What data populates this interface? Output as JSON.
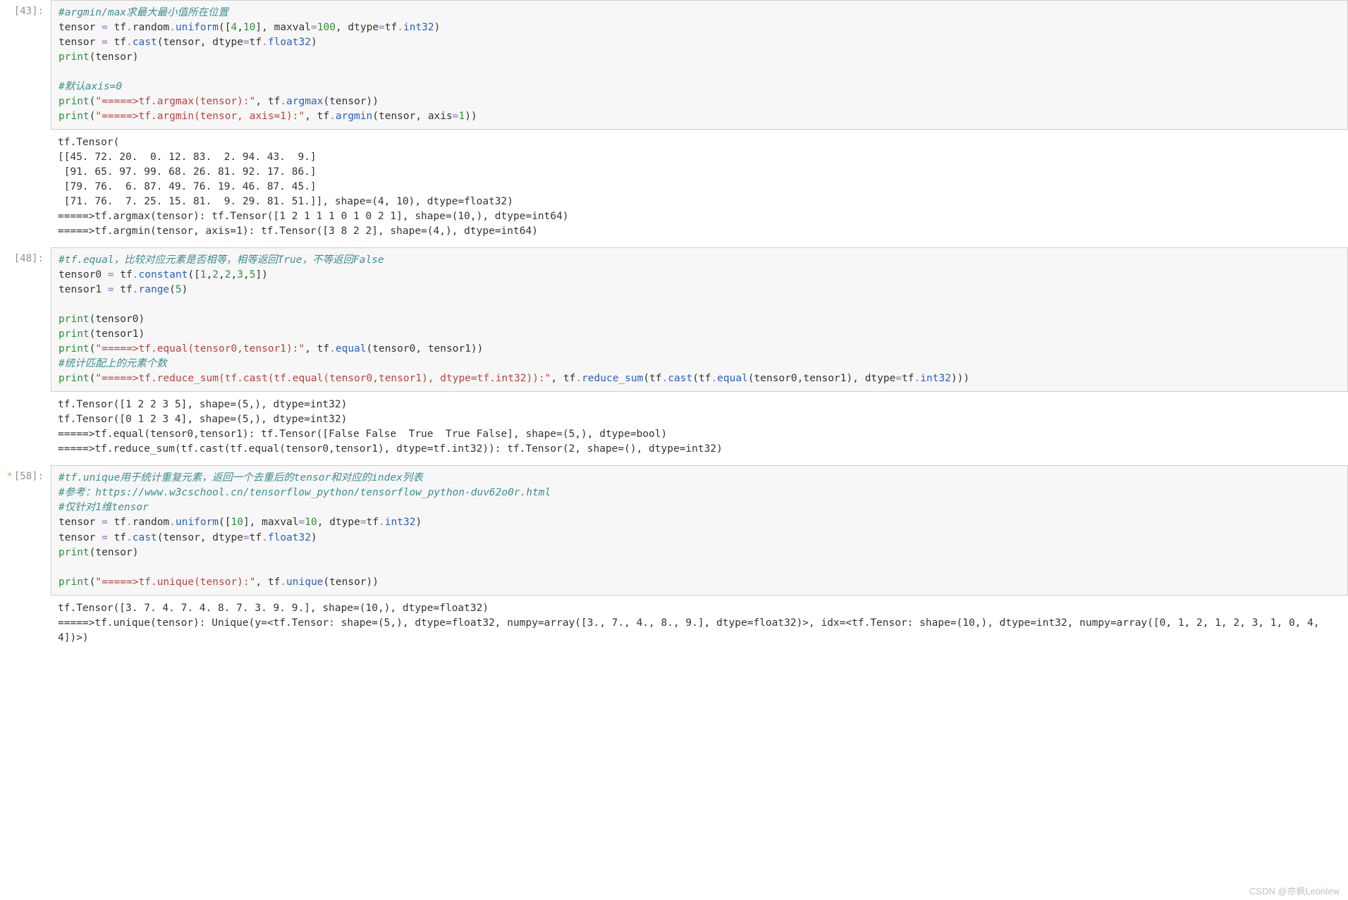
{
  "watermark": "CSDN @亦枫Leonlew",
  "cells": [
    {
      "prompt": "[43]:",
      "modified": false,
      "code": [
        {
          "cls": "c-comment",
          "t": "#argmin/max求最大最小值所在位置"
        },
        [
          {
            "cls": "",
            "t": "tensor "
          },
          {
            "cls": "c-op",
            "t": "="
          },
          {
            "cls": "",
            "t": " tf"
          },
          {
            "cls": "c-op",
            "t": "."
          },
          {
            "cls": "",
            "t": "random"
          },
          {
            "cls": "c-op",
            "t": "."
          },
          {
            "cls": "c-func",
            "t": "uniform"
          },
          {
            "cls": "",
            "t": "(["
          },
          {
            "cls": "c-num",
            "t": "4"
          },
          {
            "cls": "",
            "t": ","
          },
          {
            "cls": "c-num",
            "t": "10"
          },
          {
            "cls": "",
            "t": "], maxval"
          },
          {
            "cls": "c-op",
            "t": "="
          },
          {
            "cls": "c-num",
            "t": "100"
          },
          {
            "cls": "",
            "t": ", dtype"
          },
          {
            "cls": "c-op",
            "t": "="
          },
          {
            "cls": "",
            "t": "tf"
          },
          {
            "cls": "c-op",
            "t": "."
          },
          {
            "cls": "c-func",
            "t": "int32"
          },
          {
            "cls": "",
            "t": ")"
          }
        ],
        [
          {
            "cls": "",
            "t": "tensor "
          },
          {
            "cls": "c-op",
            "t": "="
          },
          {
            "cls": "",
            "t": " tf"
          },
          {
            "cls": "c-op",
            "t": "."
          },
          {
            "cls": "c-func",
            "t": "cast"
          },
          {
            "cls": "",
            "t": "(tensor, dtype"
          },
          {
            "cls": "c-op",
            "t": "="
          },
          {
            "cls": "",
            "t": "tf"
          },
          {
            "cls": "c-op",
            "t": "."
          },
          {
            "cls": "c-func",
            "t": "float32"
          },
          {
            "cls": "",
            "t": ")"
          }
        ],
        [
          {
            "cls": "c-kw",
            "t": "print"
          },
          {
            "cls": "",
            "t": "(tensor)"
          }
        ],
        {
          "blank": true
        },
        {
          "cls": "c-comment",
          "t": "#默认axis=0"
        },
        [
          {
            "cls": "c-kw",
            "t": "print"
          },
          {
            "cls": "",
            "t": "("
          },
          {
            "cls": "c-str",
            "t": "\"=====>tf.argmax(tensor):\""
          },
          {
            "cls": "",
            "t": ", tf"
          },
          {
            "cls": "c-op",
            "t": "."
          },
          {
            "cls": "c-func",
            "t": "argmax"
          },
          {
            "cls": "",
            "t": "(tensor))"
          }
        ],
        [
          {
            "cls": "c-kw",
            "t": "print"
          },
          {
            "cls": "",
            "t": "("
          },
          {
            "cls": "c-str",
            "t": "\"=====>tf.argmin(tensor, axis=1):\""
          },
          {
            "cls": "",
            "t": ", tf"
          },
          {
            "cls": "c-op",
            "t": "."
          },
          {
            "cls": "c-func",
            "t": "argmin"
          },
          {
            "cls": "",
            "t": "(tensor, axis"
          },
          {
            "cls": "c-op",
            "t": "="
          },
          {
            "cls": "c-num",
            "t": "1"
          },
          {
            "cls": "",
            "t": "))"
          }
        ]
      ],
      "output": "tf.Tensor(\n[[45. 72. 20.  0. 12. 83.  2. 94. 43.  9.]\n [91. 65. 97. 99. 68. 26. 81. 92. 17. 86.]\n [79. 76.  6. 87. 49. 76. 19. 46. 87. 45.]\n [71. 76.  7. 25. 15. 81.  9. 29. 81. 51.]], shape=(4, 10), dtype=float32)\n=====>tf.argmax(tensor): tf.Tensor([1 2 1 1 1 0 1 0 2 1], shape=(10,), dtype=int64)\n=====>tf.argmin(tensor, axis=1): tf.Tensor([3 8 2 2], shape=(4,), dtype=int64)"
    },
    {
      "prompt": "[48]:",
      "modified": false,
      "code": [
        {
          "cls": "c-comment",
          "t": "#tf.equal，比较对应元素是否相等，相等返回True，不等返回False"
        },
        [
          {
            "cls": "",
            "t": "tensor0 "
          },
          {
            "cls": "c-op",
            "t": "="
          },
          {
            "cls": "",
            "t": " tf"
          },
          {
            "cls": "c-op",
            "t": "."
          },
          {
            "cls": "c-func",
            "t": "constant"
          },
          {
            "cls": "",
            "t": "(["
          },
          {
            "cls": "c-num",
            "t": "1"
          },
          {
            "cls": "",
            "t": ","
          },
          {
            "cls": "c-num",
            "t": "2"
          },
          {
            "cls": "",
            "t": ","
          },
          {
            "cls": "c-num",
            "t": "2"
          },
          {
            "cls": "",
            "t": ","
          },
          {
            "cls": "c-num",
            "t": "3"
          },
          {
            "cls": "",
            "t": ","
          },
          {
            "cls": "c-num",
            "t": "5"
          },
          {
            "cls": "",
            "t": "])"
          }
        ],
        [
          {
            "cls": "",
            "t": "tensor1 "
          },
          {
            "cls": "c-op",
            "t": "="
          },
          {
            "cls": "",
            "t": " tf"
          },
          {
            "cls": "c-op",
            "t": "."
          },
          {
            "cls": "c-func",
            "t": "range"
          },
          {
            "cls": "",
            "t": "("
          },
          {
            "cls": "c-num",
            "t": "5"
          },
          {
            "cls": "",
            "t": ")"
          }
        ],
        {
          "blank": true
        },
        [
          {
            "cls": "c-kw",
            "t": "print"
          },
          {
            "cls": "",
            "t": "(tensor0)"
          }
        ],
        [
          {
            "cls": "c-kw",
            "t": "print"
          },
          {
            "cls": "",
            "t": "(tensor1)"
          }
        ],
        [
          {
            "cls": "c-kw",
            "t": "print"
          },
          {
            "cls": "",
            "t": "("
          },
          {
            "cls": "c-str",
            "t": "\"=====>tf.equal(tensor0,tensor1):\""
          },
          {
            "cls": "",
            "t": ", tf"
          },
          {
            "cls": "c-op",
            "t": "."
          },
          {
            "cls": "c-func",
            "t": "equal"
          },
          {
            "cls": "",
            "t": "(tensor0, tensor1))"
          }
        ],
        {
          "cls": "c-comment",
          "t": "#统计匹配上的元素个数"
        },
        [
          {
            "cls": "c-kw",
            "t": "print"
          },
          {
            "cls": "",
            "t": "("
          },
          {
            "cls": "c-str",
            "t": "\"=====>tf.reduce_sum(tf.cast(tf.equal(tensor0,tensor1), dtype=tf.int32)):\""
          },
          {
            "cls": "",
            "t": ", tf"
          },
          {
            "cls": "c-op",
            "t": "."
          },
          {
            "cls": "c-func",
            "t": "reduce_sum"
          },
          {
            "cls": "",
            "t": "(tf"
          },
          {
            "cls": "c-op",
            "t": "."
          },
          {
            "cls": "c-func",
            "t": "cast"
          },
          {
            "cls": "",
            "t": "(tf"
          },
          {
            "cls": "c-op",
            "t": "."
          },
          {
            "cls": "c-func",
            "t": "equal"
          },
          {
            "cls": "",
            "t": "(tensor0,tensor1), dtype"
          },
          {
            "cls": "c-op",
            "t": "="
          },
          {
            "cls": "",
            "t": "tf"
          },
          {
            "cls": "c-op",
            "t": "."
          },
          {
            "cls": "c-func",
            "t": "int32"
          },
          {
            "cls": "",
            "t": ")))"
          }
        ]
      ],
      "output": "tf.Tensor([1 2 2 3 5], shape=(5,), dtype=int32)\ntf.Tensor([0 1 2 3 4], shape=(5,), dtype=int32)\n=====>tf.equal(tensor0,tensor1): tf.Tensor([False False  True  True False], shape=(5,), dtype=bool)\n=====>tf.reduce_sum(tf.cast(tf.equal(tensor0,tensor1), dtype=tf.int32)): tf.Tensor(2, shape=(), dtype=int32)"
    },
    {
      "prompt": "[58]:",
      "modified": true,
      "code": [
        {
          "cls": "c-comment",
          "t": "#tf.unique用于统计重复元素，返回一个去重后的tensor和对应的index列表"
        },
        {
          "cls": "c-comment",
          "t": "#参考：https://www.w3cschool.cn/tensorflow_python/tensorflow_python-duv62o0r.html"
        },
        {
          "cls": "c-comment",
          "t": "#仅针对1维tensor"
        },
        [
          {
            "cls": "",
            "t": "tensor "
          },
          {
            "cls": "c-op",
            "t": "="
          },
          {
            "cls": "",
            "t": " tf"
          },
          {
            "cls": "c-op",
            "t": "."
          },
          {
            "cls": "",
            "t": "random"
          },
          {
            "cls": "c-op",
            "t": "."
          },
          {
            "cls": "c-func",
            "t": "uniform"
          },
          {
            "cls": "",
            "t": "(["
          },
          {
            "cls": "c-num",
            "t": "10"
          },
          {
            "cls": "",
            "t": "], maxval"
          },
          {
            "cls": "c-op",
            "t": "="
          },
          {
            "cls": "c-num",
            "t": "10"
          },
          {
            "cls": "",
            "t": ", dtype"
          },
          {
            "cls": "c-op",
            "t": "="
          },
          {
            "cls": "",
            "t": "tf"
          },
          {
            "cls": "c-op",
            "t": "."
          },
          {
            "cls": "c-func",
            "t": "int32"
          },
          {
            "cls": "",
            "t": ")"
          }
        ],
        [
          {
            "cls": "",
            "t": "tensor "
          },
          {
            "cls": "c-op",
            "t": "="
          },
          {
            "cls": "",
            "t": " tf"
          },
          {
            "cls": "c-op",
            "t": "."
          },
          {
            "cls": "c-func",
            "t": "cast"
          },
          {
            "cls": "",
            "t": "(tensor, dtype"
          },
          {
            "cls": "c-op",
            "t": "="
          },
          {
            "cls": "",
            "t": "tf"
          },
          {
            "cls": "c-op",
            "t": "."
          },
          {
            "cls": "c-func",
            "t": "float32"
          },
          {
            "cls": "",
            "t": ")"
          }
        ],
        [
          {
            "cls": "c-kw",
            "t": "print"
          },
          {
            "cls": "",
            "t": "(tensor)"
          }
        ],
        {
          "blank": true
        },
        [
          {
            "cls": "c-kw",
            "t": "print"
          },
          {
            "cls": "",
            "t": "("
          },
          {
            "cls": "c-str",
            "t": "\"=====>tf.unique(tensor):\""
          },
          {
            "cls": "",
            "t": ", tf"
          },
          {
            "cls": "c-op",
            "t": "."
          },
          {
            "cls": "c-func",
            "t": "unique"
          },
          {
            "cls": "",
            "t": "(tensor))"
          }
        ]
      ],
      "output": "tf.Tensor([3. 7. 4. 7. 4. 8. 7. 3. 9. 9.], shape=(10,), dtype=float32)\n=====>tf.unique(tensor): Unique(y=<tf.Tensor: shape=(5,), dtype=float32, numpy=array([3., 7., 4., 8., 9.], dtype=float32)>, idx=<tf.Tensor: shape=(10,), dtype=int32, numpy=array([0, 1, 2, 1, 2, 3, 1, 0, 4, 4])>)"
    }
  ]
}
